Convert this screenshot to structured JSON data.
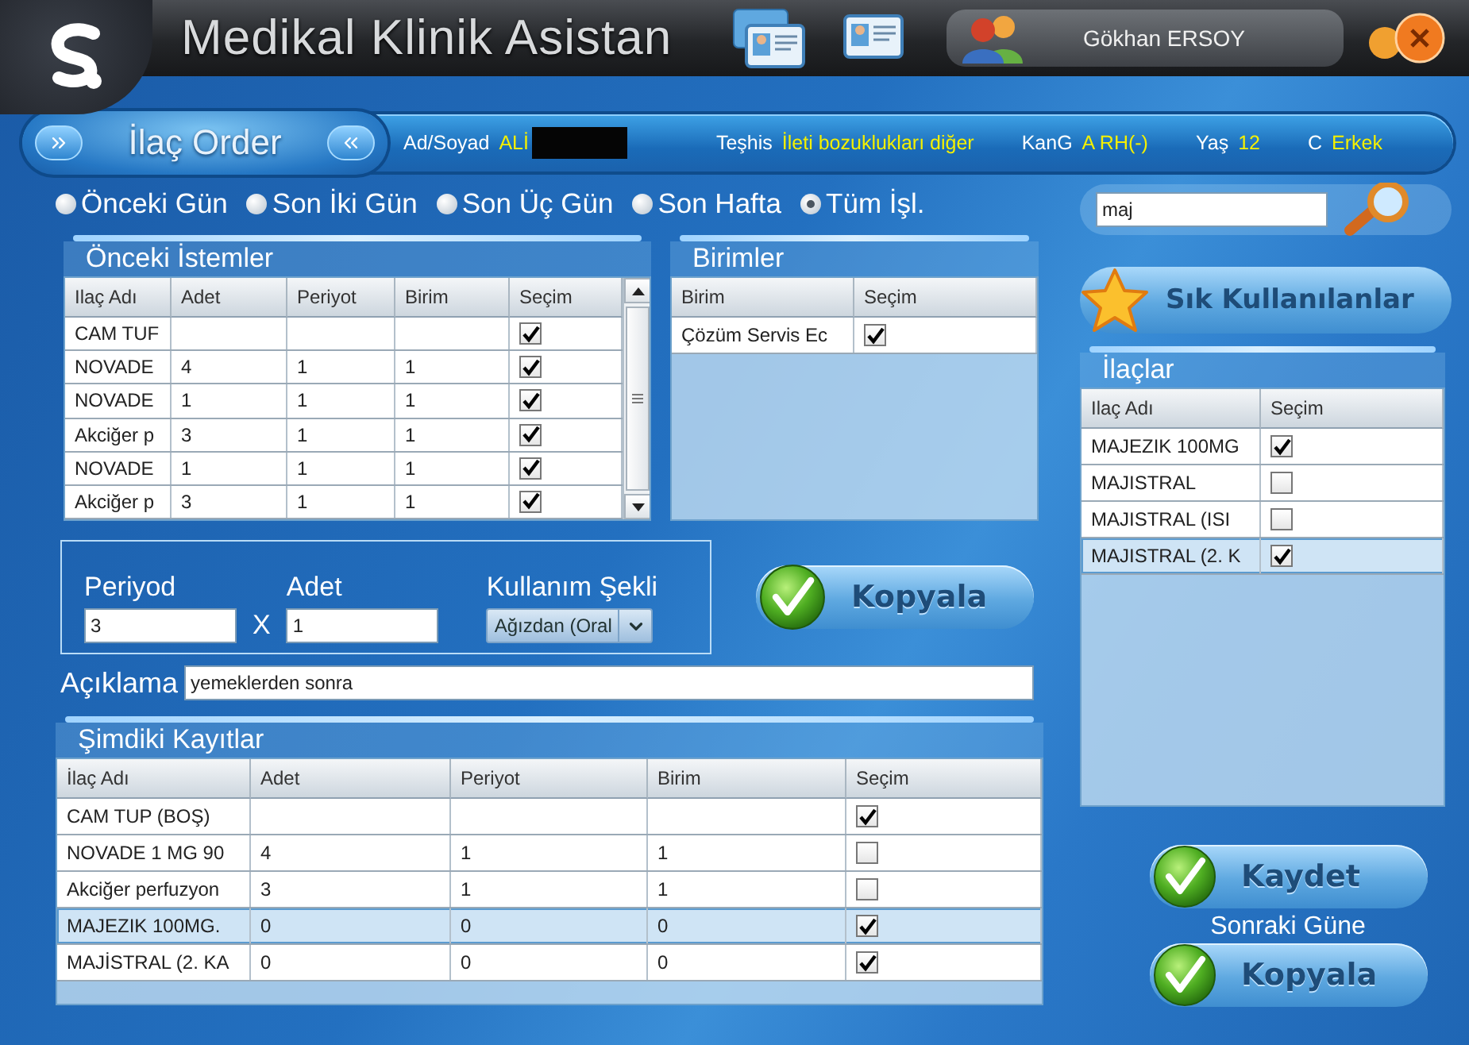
{
  "app": {
    "title": "Medikal Klinik Asistan"
  },
  "user": {
    "name": "Gökhan ERSOY"
  },
  "patient_bar": {
    "title": "İlaç Order",
    "fields": [
      {
        "label": "Ad/Soyad",
        "value": "ALİ",
        "kind": "redacted"
      },
      {
        "label": "Teşhis",
        "value": "İleti bozuklukları diğer",
        "kind": "plain"
      },
      {
        "label": "KanG",
        "value": "A RH(-)",
        "kind": "plain"
      },
      {
        "label": "Yaş",
        "value": "12",
        "kind": "plain"
      },
      {
        "label": "C",
        "value": "Erkek",
        "kind": "plain"
      }
    ]
  },
  "radios": [
    {
      "label": "Önceki Gün",
      "selected": false
    },
    {
      "label": "Son İki Gün",
      "selected": false
    },
    {
      "label": "Son Üç Gün",
      "selected": false
    },
    {
      "label": "Son Hafta",
      "selected": false
    },
    {
      "label": "Tüm İşl.",
      "selected": true
    }
  ],
  "previous_orders": {
    "title": "Önceki İstemler",
    "columns": [
      "Ilaç Adı",
      "Adet",
      "Periyot",
      "Birim",
      "Seçim"
    ],
    "rows": [
      {
        "drug": "CAM TUF",
        "checked": true
      },
      {
        "drug": "NOVADE",
        "count": "4",
        "period": "1",
        "unit": "1",
        "checked": true
      },
      {
        "drug": "NOVADE",
        "count": "1",
        "period": "1",
        "unit": "1",
        "checked": true
      },
      {
        "drug": "Akciğer p",
        "count": "3",
        "period": "1",
        "unit": "1",
        "checked": true
      },
      {
        "drug": "NOVADE",
        "count": "1",
        "period": "1",
        "unit": "1",
        "checked": true
      },
      {
        "drug": "Akciğer p",
        "count": "3",
        "period": "1",
        "unit": "1",
        "checked": true
      }
    ]
  },
  "units": {
    "title": "Birimler",
    "columns": [
      "Birim",
      "Seçim"
    ],
    "rows": [
      {
        "unit": "Çözüm Servis Ec",
        "checked": true
      }
    ]
  },
  "dosage": {
    "period_label": "Periyod",
    "period_value": "3",
    "times": "X",
    "count_label": "Adet",
    "count_value": "1",
    "usage_label": "Kullanım Şekli",
    "usage_value": "Ağızdan (Oral"
  },
  "copy_button": "Kopyala",
  "note": {
    "label": "Açıklama",
    "value": "yemeklerden sonra"
  },
  "current_records": {
    "title": "Şimdiki Kayıtlar",
    "columns": [
      "İlaç Adı",
      "Adet",
      "Periyot",
      "Birim",
      "Seçim"
    ],
    "rows": [
      {
        "drug": "CAM TUP (BOŞ)",
        "checked": true,
        "selected": false
      },
      {
        "drug": "NOVADE 1 MG 90",
        "count": "4",
        "period": "1",
        "unit": "1",
        "checked": false,
        "selected": false
      },
      {
        "drug": "Akciğer perfuzyon",
        "count": "3",
        "period": "1",
        "unit": "1",
        "checked": false,
        "selected": false
      },
      {
        "drug": "MAJEZIK 100MG.",
        "count": "0",
        "period": "0",
        "unit": "0",
        "checked": true,
        "selected": true
      },
      {
        "drug": "MAJİSTRAL (2. KA",
        "count": "0",
        "period": "0",
        "unit": "0",
        "checked": true,
        "selected": false
      }
    ]
  },
  "search": {
    "value": "maj"
  },
  "favorites_button": "Sık Kullanılanlar",
  "drugs": {
    "title": "İlaçlar",
    "columns": [
      "Ilaç Adı",
      "Seçim"
    ],
    "rows": [
      {
        "drug": "MAJEZIK 100MG",
        "checked": true,
        "selected": false
      },
      {
        "drug": "MAJISTRAL",
        "checked": false,
        "selected": false
      },
      {
        "drug": "MAJISTRAL (ISI",
        "checked": false,
        "selected": false
      },
      {
        "drug": "MAJISTRAL (2. K",
        "checked": true,
        "selected": true
      }
    ]
  },
  "actions": {
    "save": "Kaydet",
    "next_day_label": "Sonraki Güne",
    "copy": "Kopyala"
  }
}
